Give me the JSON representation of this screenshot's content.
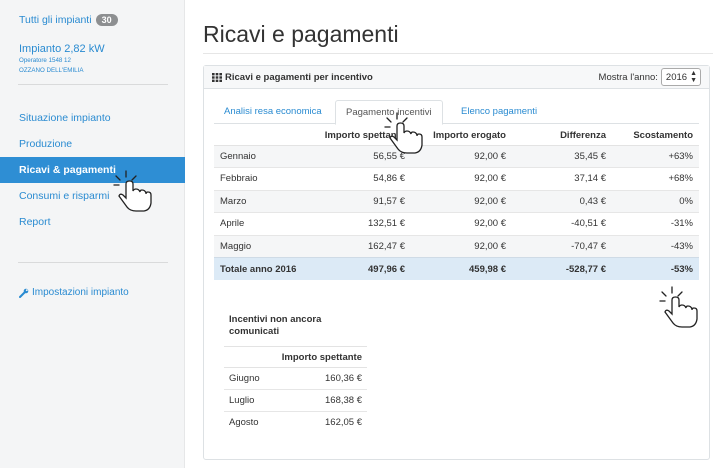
{
  "sidebar": {
    "all_plants_label": "Tutti gli impianti",
    "all_plants_count": "30",
    "plant_name": "Impianto 2,82 kW",
    "operator": "Operatore 1548 12",
    "location": "OZZANO DELL'EMILIA",
    "nav": [
      {
        "label": "Situazione impianto",
        "active": false
      },
      {
        "label": "Produzione",
        "active": false
      },
      {
        "label": "Ricavi & pagamenti",
        "active": true
      },
      {
        "label": "Consumi e risparmi",
        "active": false
      },
      {
        "label": "Report",
        "active": false
      }
    ],
    "settings_label": "Impostazioni impianto"
  },
  "page": {
    "title": "Ricavi e pagamenti"
  },
  "panel": {
    "title": "Ricavi e pagamenti per incentivo",
    "year_label": "Mostra l'anno:",
    "year_value": "2016",
    "tabs": [
      {
        "label": "Analisi resa economica",
        "active": false
      },
      {
        "label": "Pagamento incentivi",
        "active": true
      },
      {
        "label": "Elenco pagamenti",
        "active": false
      }
    ],
    "columns": [
      "",
      "Importo spettante",
      "Importo erogato",
      "Differenza",
      "Scostamento"
    ],
    "rows": [
      {
        "month": "Gennaio",
        "spettante": "56,55 €",
        "erogato": "92,00 €",
        "differenza": "35,45 €",
        "scostamento": "+63%"
      },
      {
        "month": "Febbraio",
        "spettante": "54,86 €",
        "erogato": "92,00 €",
        "differenza": "37,14 €",
        "scostamento": "+68%"
      },
      {
        "month": "Marzo",
        "spettante": "91,57 €",
        "erogato": "92,00 €",
        "differenza": "0,43 €",
        "scostamento": "0%"
      },
      {
        "month": "Aprile",
        "spettante": "132,51 €",
        "erogato": "92,00 €",
        "differenza": "-40,51 €",
        "scostamento": "-31%"
      },
      {
        "month": "Maggio",
        "spettante": "162,47 €",
        "erogato": "92,00 €",
        "differenza": "-70,47 €",
        "scostamento": "-43%"
      }
    ],
    "total": {
      "month": "Totale anno 2016",
      "spettante": "497,96 €",
      "erogato": "459,98 €",
      "differenza": "-528,77 €",
      "scostamento": "-53%"
    },
    "pending": {
      "title": "Incentivi non ancora comunicati",
      "column": "Importo spettante",
      "rows": [
        {
          "month": "Giugno",
          "value": "160,36 €"
        },
        {
          "month": "Luglio",
          "value": "168,38 €"
        },
        {
          "month": "Agosto",
          "value": "162,05 €"
        }
      ]
    }
  },
  "colors": {
    "link": "#2a8bd1",
    "active_nav": "#2e8ed4",
    "total_row": "#dceaf6"
  }
}
